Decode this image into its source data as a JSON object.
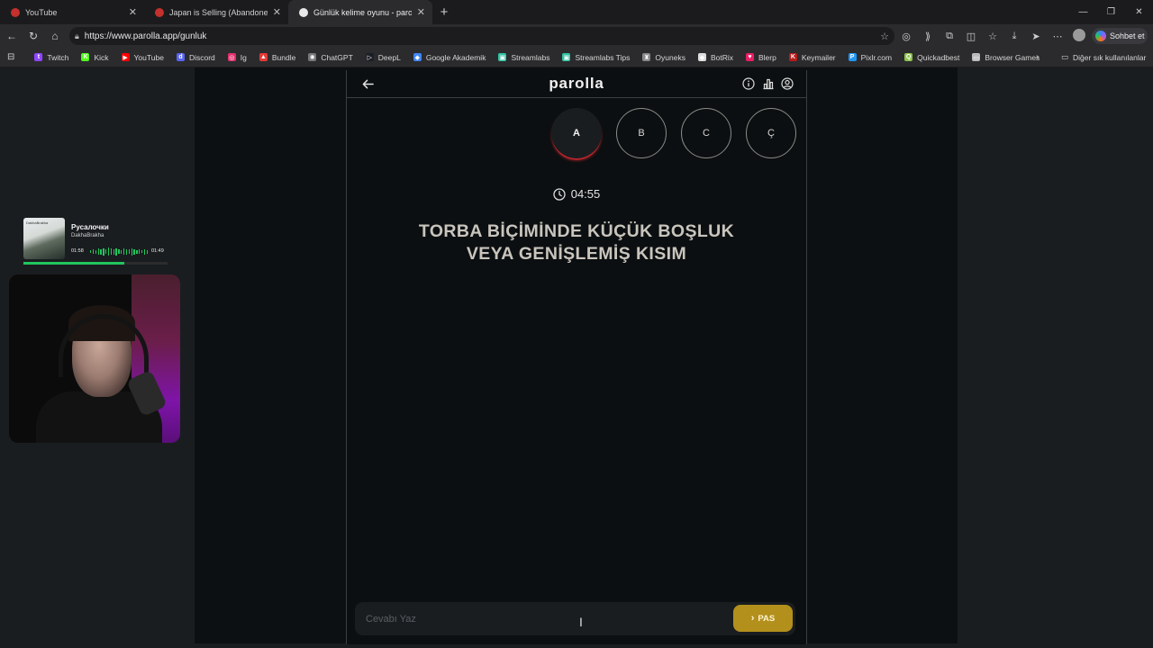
{
  "browser": {
    "tabs": [
      {
        "title": "YouTube",
        "favicon_color": "#c4302b",
        "active": false
      },
      {
        "title": "Japan is Selling (Abandoned) Hou",
        "favicon_color": "#c4302b",
        "active": false
      },
      {
        "title": "Günlük kelime oyunu - parolla - K",
        "favicon_color": "#e8e8e8",
        "active": true
      }
    ],
    "new_tab": "+",
    "url": "https://www.parolla.app/gunluk",
    "copilot_label": "Sohbet et",
    "bookmarks": [
      {
        "label": "Twitch",
        "color": "#9146ff",
        "glyph": "t"
      },
      {
        "label": "Kick",
        "color": "#53fc18",
        "glyph": "K"
      },
      {
        "label": "YouTube",
        "color": "#ff0000",
        "glyph": "▶"
      },
      {
        "label": "Discord",
        "color": "#5865f2",
        "glyph": "d"
      },
      {
        "label": "Ig",
        "color": "#e1306c",
        "glyph": "◎"
      },
      {
        "label": "Bundle",
        "color": "#e53935",
        "glyph": "▲"
      },
      {
        "label": "ChatGPT",
        "color": "#777777",
        "glyph": "✺"
      },
      {
        "label": "DeepL",
        "color": "#1b1e25",
        "glyph": "▷"
      },
      {
        "label": "Google Akademik",
        "color": "#4285f4",
        "glyph": "◆"
      },
      {
        "label": "Streamlabs",
        "color": "#31c3a2",
        "glyph": "▣"
      },
      {
        "label": "Streamlabs Tips",
        "color": "#31c3a2",
        "glyph": "▣"
      },
      {
        "label": "Oyuneks",
        "color": "#888888",
        "glyph": "♜"
      },
      {
        "label": "BotRix",
        "color": "#dddddd",
        "glyph": "◆"
      },
      {
        "label": "Blerp",
        "color": "#e91e63",
        "glyph": "♥"
      },
      {
        "label": "Keymailer",
        "color": "#b71c1c",
        "glyph": "K"
      },
      {
        "label": "Pixlr.com",
        "color": "#2196f3",
        "glyph": "P"
      },
      {
        "label": "Quickadbest",
        "color": "#8bc34a",
        "glyph": "Q"
      },
      {
        "label": "Browser Games",
        "color": "#bbbbbb",
        "glyph": "▭"
      }
    ],
    "other_bookmarks": "Diğer sık kullanılanlar"
  },
  "music": {
    "song": "Русалочки",
    "artist": "DakhaBrakha",
    "cover_text": "DakhaBrakha",
    "elapsed": "01:58",
    "duration": "01:49",
    "progress": 0.7
  },
  "game": {
    "logo": "parolla",
    "letters": [
      {
        "letter": "A",
        "current": true
      },
      {
        "letter": "B",
        "current": false
      },
      {
        "letter": "C",
        "current": false
      },
      {
        "letter": "Ç",
        "current": false
      }
    ],
    "timer": "04:55",
    "question_line1": "TORBA BİÇİMİNDE KÜÇÜK BOŞLUK",
    "question_line2": "VEYA GENİŞLEMİŞ KISIM",
    "answer_placeholder": "Cevabı Yaz",
    "answer_value": "",
    "pass_label": "PAS",
    "accent_color": "#b3901c",
    "current_letter_ring": "#c0262d"
  }
}
